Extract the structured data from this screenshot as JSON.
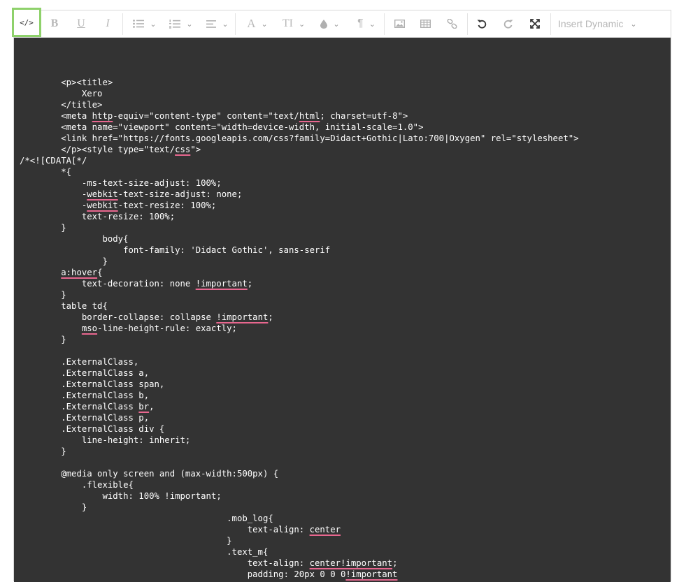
{
  "toolbar": {
    "source_label": "</>",
    "bold_label": "B",
    "underline_label": "U",
    "italic_label": "I",
    "font_label": "A",
    "font_size_label": "TI",
    "paragraph_label": "¶",
    "insert_dynamic_label": "Insert Dynamic"
  },
  "code_lines": [
    {
      "indent": "        ",
      "parts": [
        {
          "t": "<p><title>"
        }
      ]
    },
    {
      "indent": "            ",
      "parts": [
        {
          "t": "Xero"
        }
      ]
    },
    {
      "indent": "        ",
      "parts": [
        {
          "t": "</title>"
        }
      ]
    },
    {
      "indent": "        ",
      "parts": [
        {
          "t": "<meta "
        },
        {
          "t": "http",
          "sq": true
        },
        {
          "t": "-equiv=\"content-type\" content=\"text/"
        },
        {
          "t": "html",
          "sq": true
        },
        {
          "t": "; charset=utf-8\">"
        }
      ]
    },
    {
      "indent": "        ",
      "parts": [
        {
          "t": "<meta name=\"viewport\" content=\"width=device-width, initial-scale=1.0\">"
        }
      ]
    },
    {
      "indent": "        ",
      "parts": [
        {
          "t": "<link href=\"https://fonts.googleapis.com/css?family=Didact+Gothic|Lato:700|Oxygen\" rel=\"stylesheet\">"
        }
      ]
    },
    {
      "indent": "        ",
      "parts": [
        {
          "t": "</p><style type=\"text/"
        },
        {
          "t": "css",
          "sq": true
        },
        {
          "t": "\">"
        }
      ]
    },
    {
      "indent": "",
      "parts": [
        {
          "t": "/*<![CDATA[*/"
        }
      ]
    },
    {
      "indent": "        ",
      "parts": [
        {
          "t": "*{"
        }
      ]
    },
    {
      "indent": "            ",
      "parts": [
        {
          "t": "-ms-text-size-adjust: 100%;"
        }
      ]
    },
    {
      "indent": "            ",
      "parts": [
        {
          "t": "-"
        },
        {
          "t": "webkit",
          "sq": true
        },
        {
          "t": "-text-size-adjust: none;"
        }
      ]
    },
    {
      "indent": "            ",
      "parts": [
        {
          "t": "-"
        },
        {
          "t": "webkit",
          "sq": true
        },
        {
          "t": "-text-resize: 100%;"
        }
      ]
    },
    {
      "indent": "            ",
      "parts": [
        {
          "t": "text-resize: 100%;"
        }
      ]
    },
    {
      "indent": "        ",
      "parts": [
        {
          "t": "}"
        }
      ]
    },
    {
      "indent": "                ",
      "parts": [
        {
          "t": "body{"
        }
      ]
    },
    {
      "indent": "                    ",
      "parts": [
        {
          "t": "font-family: 'Didact Gothic', sans-serif"
        }
      ]
    },
    {
      "indent": "                ",
      "parts": [
        {
          "t": "}"
        }
      ]
    },
    {
      "indent": "        ",
      "parts": [
        {
          "t": "a:hover",
          "sq": true
        },
        {
          "t": "{"
        }
      ]
    },
    {
      "indent": "            ",
      "parts": [
        {
          "t": "text-decoration: none "
        },
        {
          "t": "!important",
          "sq": true
        },
        {
          "t": ";"
        }
      ]
    },
    {
      "indent": "        ",
      "parts": [
        {
          "t": "}"
        }
      ]
    },
    {
      "indent": "        ",
      "parts": [
        {
          "t": "table td{"
        }
      ]
    },
    {
      "indent": "            ",
      "parts": [
        {
          "t": "border-collapse: collapse "
        },
        {
          "t": "!important",
          "sq": true
        },
        {
          "t": ";"
        }
      ]
    },
    {
      "indent": "            ",
      "parts": [
        {
          "t": "mso",
          "sq": true
        },
        {
          "t": "-line-height-rule: exactly;"
        }
      ]
    },
    {
      "indent": "        ",
      "parts": [
        {
          "t": "}"
        }
      ]
    },
    {
      "indent": "",
      "parts": [
        {
          "t": ""
        }
      ]
    },
    {
      "indent": "        ",
      "parts": [
        {
          "t": ".ExternalClass,"
        }
      ]
    },
    {
      "indent": "        ",
      "parts": [
        {
          "t": ".ExternalClass a,"
        }
      ]
    },
    {
      "indent": "        ",
      "parts": [
        {
          "t": ".ExternalClass span,"
        }
      ]
    },
    {
      "indent": "        ",
      "parts": [
        {
          "t": ".ExternalClass b,"
        }
      ]
    },
    {
      "indent": "        ",
      "parts": [
        {
          "t": ".ExternalClass "
        },
        {
          "t": "br",
          "sq": true
        },
        {
          "t": ","
        }
      ]
    },
    {
      "indent": "        ",
      "parts": [
        {
          "t": ".ExternalClass p,"
        }
      ]
    },
    {
      "indent": "        ",
      "parts": [
        {
          "t": ".ExternalClass div {"
        }
      ]
    },
    {
      "indent": "            ",
      "parts": [
        {
          "t": "line-height: inherit;"
        }
      ]
    },
    {
      "indent": "        ",
      "parts": [
        {
          "t": "}"
        }
      ]
    },
    {
      "indent": "",
      "parts": [
        {
          "t": ""
        }
      ]
    },
    {
      "indent": "        ",
      "parts": [
        {
          "t": "@media only screen and (max-width:500px) {"
        }
      ]
    },
    {
      "indent": "            ",
      "parts": [
        {
          "t": ".flexible{"
        }
      ]
    },
    {
      "indent": "                ",
      "parts": [
        {
          "t": "width: 100% !important;"
        }
      ]
    },
    {
      "indent": "            ",
      "parts": [
        {
          "t": "}"
        }
      ]
    },
    {
      "indent": "                                        ",
      "parts": [
        {
          "t": ".mob_log{"
        }
      ]
    },
    {
      "indent": "                                            ",
      "parts": [
        {
          "t": "text-align: "
        },
        {
          "t": "center",
          "sq": true
        }
      ]
    },
    {
      "indent": "                                        ",
      "parts": [
        {
          "t": "}"
        }
      ]
    },
    {
      "indent": "                                        ",
      "parts": [
        {
          "t": ".text_m{"
        }
      ]
    },
    {
      "indent": "                                            ",
      "parts": [
        {
          "t": "text-align: "
        },
        {
          "t": "center!important",
          "sq": true
        },
        {
          "t": ";"
        }
      ]
    },
    {
      "indent": "                                            ",
      "parts": [
        {
          "t": "padding: 20px 0 0 0"
        },
        {
          "t": "!important",
          "sq": true
        }
      ]
    }
  ]
}
